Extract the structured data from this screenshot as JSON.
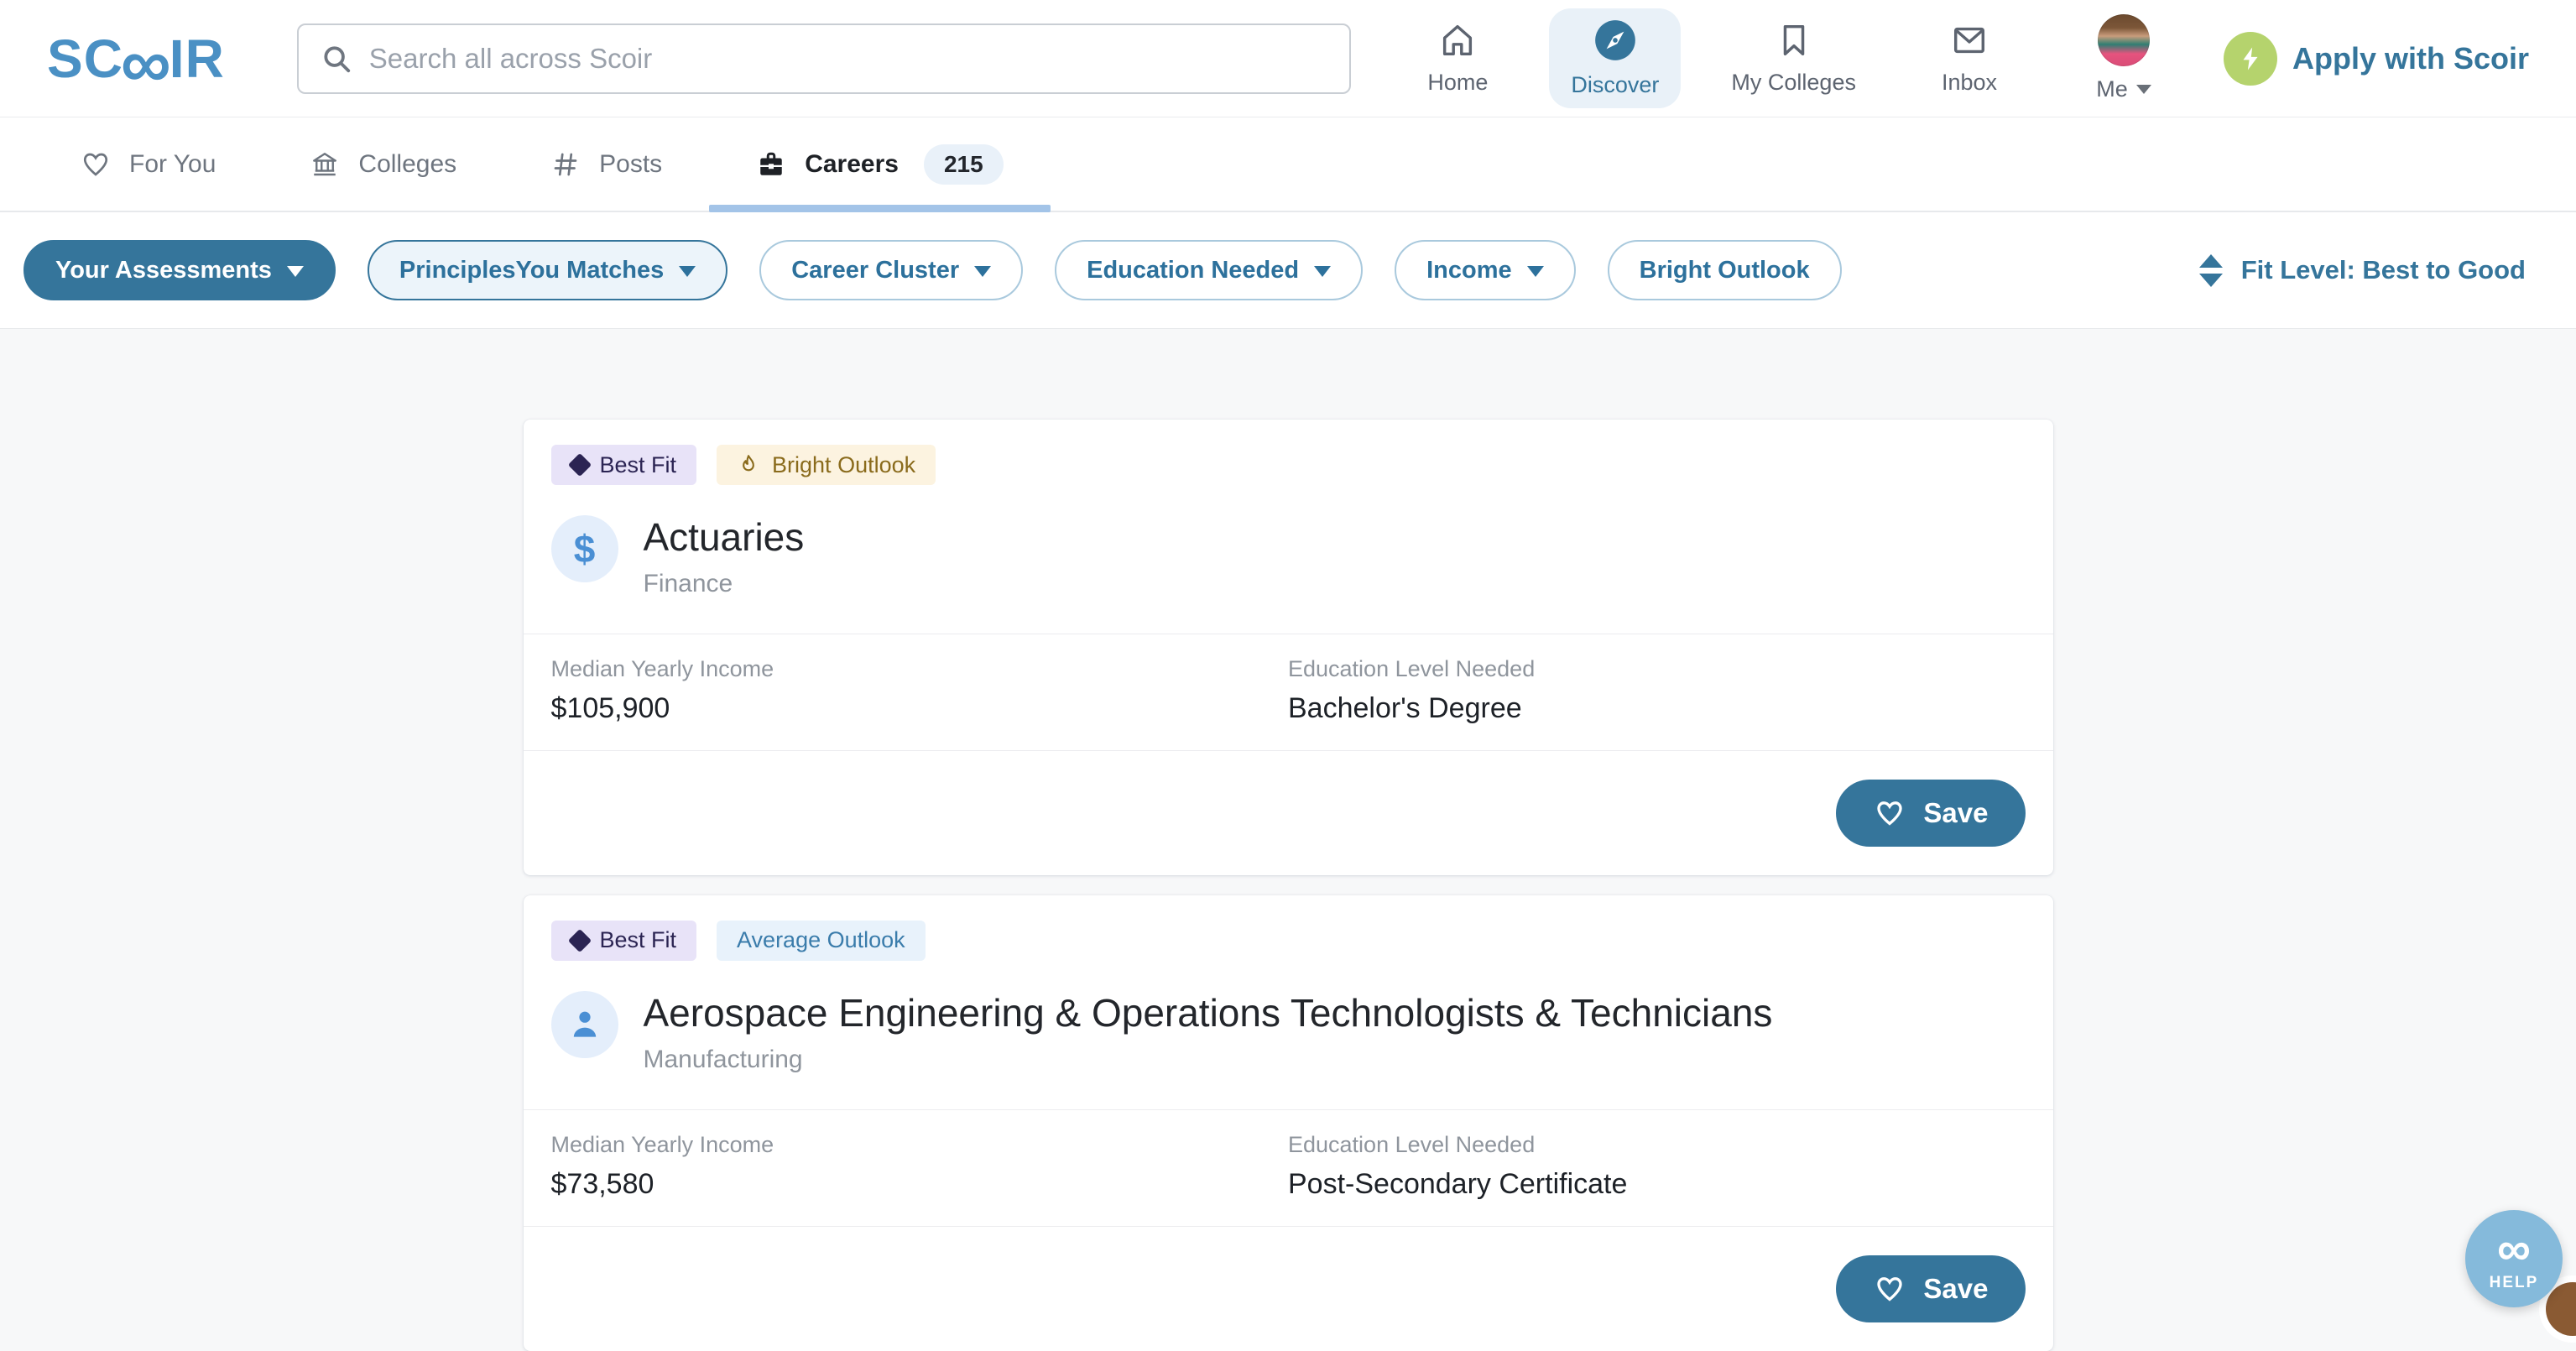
{
  "brand": {
    "logo_prefix": "SC",
    "logo_infinity": "∞",
    "logo_suffix": "IR"
  },
  "header": {
    "search": {
      "placeholder": "Search all across Scoir",
      "value": ""
    },
    "nav": [
      {
        "label": "Home",
        "icon": "home-icon",
        "active": false
      },
      {
        "label": "Discover",
        "icon": "compass-icon",
        "active": true
      },
      {
        "label": "My Colleges",
        "icon": "bookmark-icon",
        "active": false
      },
      {
        "label": "Inbox",
        "icon": "envelope-icon",
        "active": false
      },
      {
        "label": "Me",
        "icon": "avatar",
        "active": false
      }
    ],
    "apply": {
      "label": "Apply with Scoir",
      "icon": "lightning-bolt-icon"
    }
  },
  "tabs": [
    {
      "label": "For You",
      "icon": "heart-icon",
      "active": false
    },
    {
      "label": "Colleges",
      "icon": "bank-icon",
      "active": false
    },
    {
      "label": "Posts",
      "icon": "hash-icon",
      "active": false
    },
    {
      "label": "Careers",
      "icon": "briefcase-icon",
      "active": true,
      "count": "215"
    }
  ],
  "filters": [
    {
      "label": "Your Assessments",
      "style": "solid",
      "caret": true
    },
    {
      "label": "PrinciplesYou Matches",
      "style": "tinted",
      "caret": true
    },
    {
      "label": "Career Cluster",
      "style": "outline",
      "caret": true
    },
    {
      "label": "Education Needed",
      "style": "outline",
      "caret": true
    },
    {
      "label": "Income",
      "style": "outline",
      "caret": true
    },
    {
      "label": "Bright Outlook",
      "style": "outline",
      "caret": false
    }
  ],
  "sort": {
    "label": "Fit Level: Best to Good",
    "icon": "sort-arrows-icon"
  },
  "cards": [
    {
      "badges": [
        {
          "label": "Best Fit",
          "type": "best-fit",
          "icon": "diamond-icon"
        },
        {
          "label": "Bright Outlook",
          "type": "bright-outlook",
          "icon": "flame-icon"
        }
      ],
      "icon": "dollar-icon",
      "dollar_glyph": "$",
      "title": "Actuaries",
      "category": "Finance",
      "stats": [
        {
          "label": "Median Yearly Income",
          "value": "$105,900"
        },
        {
          "label": "Education Level Needed",
          "value": "Bachelor's Degree"
        }
      ],
      "save_label": "Save"
    },
    {
      "badges": [
        {
          "label": "Best Fit",
          "type": "best-fit",
          "icon": "diamond-icon"
        },
        {
          "label": "Average Outlook",
          "type": "average-outlook"
        }
      ],
      "icon": "person-icon",
      "title": "Aerospace Engineering & Operations Technologists & Technicians",
      "category": "Manufacturing",
      "stats": [
        {
          "label": "Median Yearly Income",
          "value": "$73,580"
        },
        {
          "label": "Education Level Needed",
          "value": "Post-Secondary Certificate"
        }
      ],
      "save_label": "Save"
    }
  ],
  "help": {
    "infinity": "∞",
    "label": "HELP"
  },
  "colors": {
    "primary_blue": "#35759b",
    "logo_blue": "#4a90c4",
    "apply_green": "#b5d36d",
    "tab_underline": "#a3c4e8",
    "best_fit_bg": "#e8e3f8",
    "best_fit_text": "#2b2453",
    "bright_outlook_bg": "#fcf3e0",
    "bright_outlook_text": "#8a6b1c",
    "average_outlook_bg": "#e8f2fb",
    "average_outlook_text": "#3a7cab",
    "icon_circle_bg": "#e4eefb",
    "icon_blue": "#4a8fd4",
    "help_bg": "#85badb",
    "page_bg": "#f7f8f9"
  }
}
